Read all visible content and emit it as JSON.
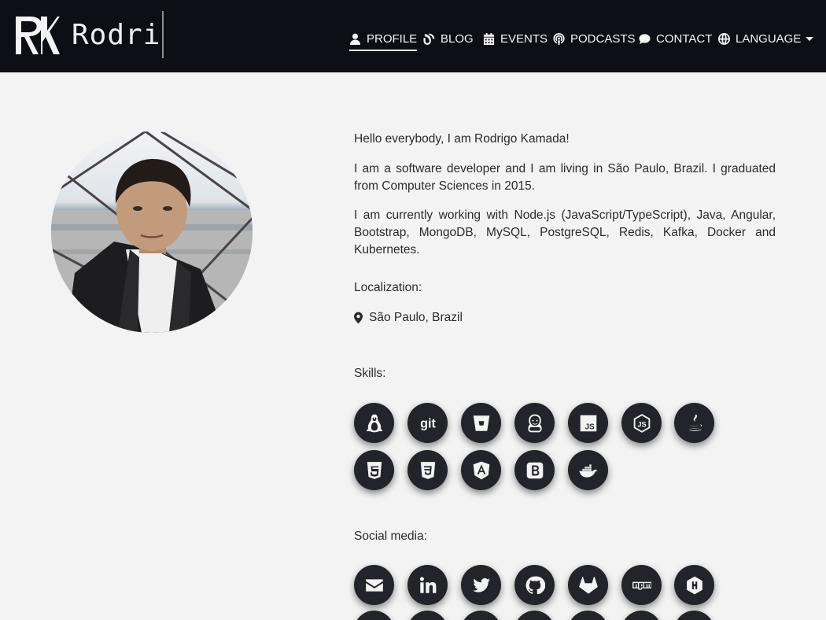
{
  "brand": {
    "text": "Rodri"
  },
  "nav": [
    {
      "label": "PROFILE",
      "icon": "user-icon"
    },
    {
      "label": "BLOG",
      "icon": "blog-icon"
    },
    {
      "label": "EVENTS",
      "icon": "calendar-icon"
    },
    {
      "label": "PODCASTS",
      "icon": "podcast-icon"
    },
    {
      "label": "CONTACT",
      "icon": "comment-icon"
    },
    {
      "label": "LANGUAGE",
      "icon": "globe-icon"
    }
  ],
  "about": {
    "p1": "Hello everybody, I am Rodrigo Kamada!",
    "p2": "I am a software developer and I am living in São Paulo, Brazil. I graduated from Computer Sciences in 2015.",
    "p3": "I am currently working with Node.js (JavaScript/TypeScript), Java, Angular, Bootstrap, MongoDB, MySQL, PostgreSQL, Redis, Kafka, Docker and Kubernetes."
  },
  "localization": {
    "heading": "Localization:",
    "value": "São Paulo, Brazil"
  },
  "skills": {
    "heading": "Skills:",
    "items": [
      "linux-icon",
      "git-icon",
      "bitbucket-icon",
      "jenkins-icon",
      "javascript-icon",
      "nodejs-icon",
      "java-icon",
      "html5-icon",
      "css3-icon",
      "angular-icon",
      "bootstrap-icon",
      "docker-icon"
    ]
  },
  "social": {
    "heading": "Social media:",
    "items": [
      "email-icon",
      "linkedin-icon",
      "twitter-icon",
      "github-icon",
      "gitlab-icon",
      "npm-icon",
      "hashnode-icon"
    ]
  },
  "colors": {
    "navbar": "#0e0e17",
    "page": "#f3f3f3",
    "icon_circle": "#23242a"
  }
}
